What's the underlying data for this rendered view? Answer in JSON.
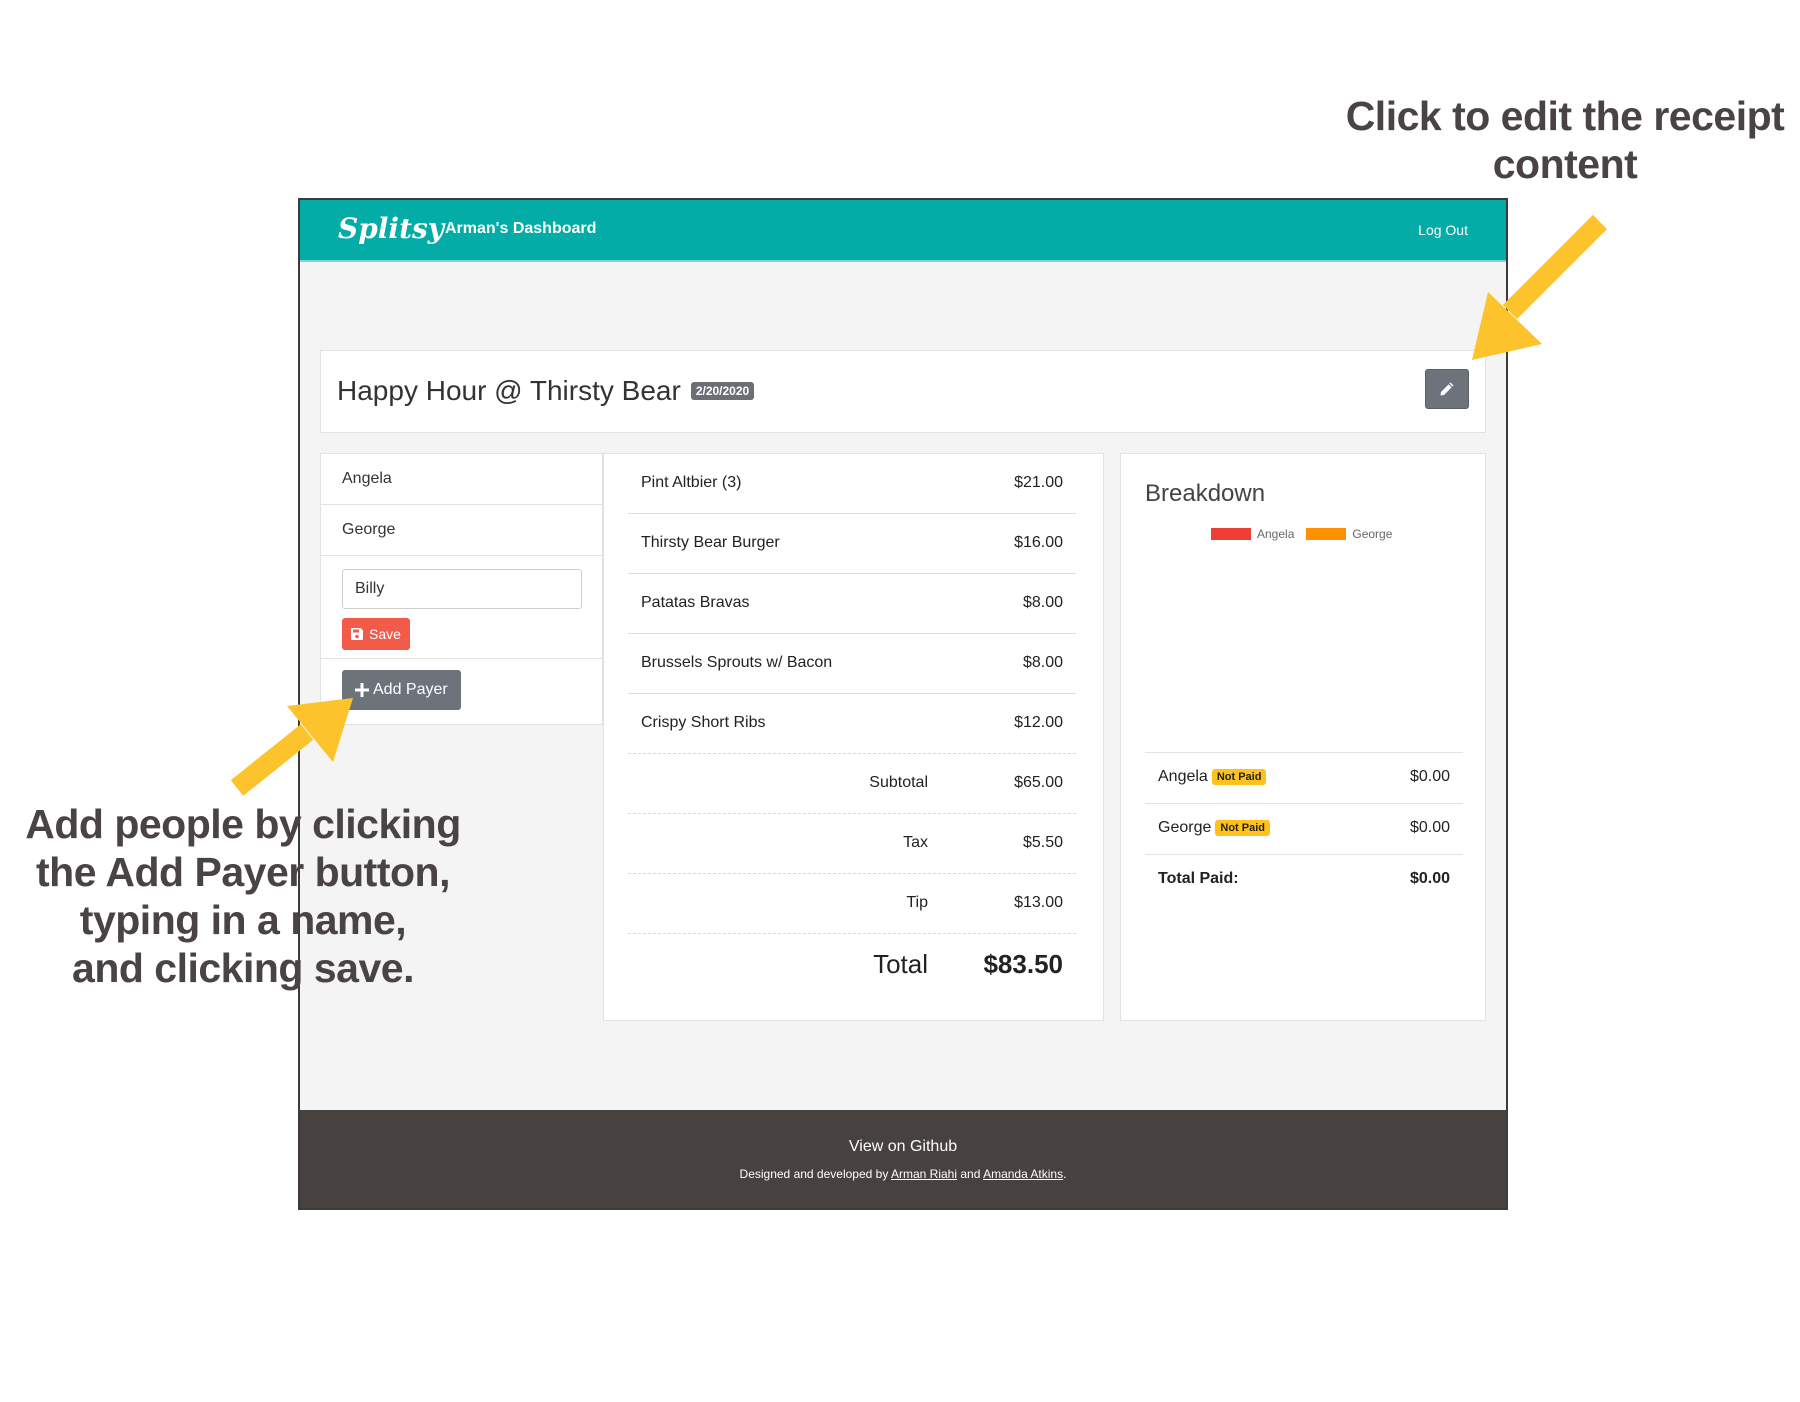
{
  "annotations": {
    "top_line1": "Click to edit the receipt",
    "top_line2": "content",
    "left_line1": "Add people by clicking",
    "left_line2": "the Add Payer button,",
    "left_line3": "typing in a name,",
    "left_line4": "and clicking save."
  },
  "navbar": {
    "brand": "Splitsy",
    "dashboard_title": "Arman's Dashboard",
    "logout_label": "Log Out"
  },
  "receipt": {
    "title": "Happy Hour @ Thirsty Bear",
    "date": "2/20/2020"
  },
  "payers": {
    "items": [
      {
        "name": "Angela"
      },
      {
        "name": "George"
      }
    ],
    "input_value": "Billy",
    "save_label": "Save",
    "add_label": "Add Payer"
  },
  "items": [
    {
      "name": "Pint Altbier (3)",
      "price": "$21.00"
    },
    {
      "name": "Thirsty Bear Burger",
      "price": "$16.00"
    },
    {
      "name": "Patatas Bravas",
      "price": "$8.00"
    },
    {
      "name": "Brussels Sprouts w/ Bacon",
      "price": "$8.00"
    },
    {
      "name": "Crispy Short Ribs",
      "price": "$12.00"
    }
  ],
  "totals": {
    "subtotal_label": "Subtotal",
    "subtotal": "$65.00",
    "tax_label": "Tax",
    "tax": "$5.50",
    "tip_label": "Tip",
    "tip": "$13.00",
    "total_label": "Total",
    "total": "$83.50"
  },
  "breakdown": {
    "title": "Breakdown",
    "legend": [
      {
        "name": "Angela",
        "color": "#ef3e36"
      },
      {
        "name": "George",
        "color": "#ff9000"
      }
    ],
    "rows": [
      {
        "name": "Angela",
        "status": "Not Paid",
        "amount": "$0.00"
      },
      {
        "name": "George",
        "status": "Not Paid",
        "amount": "$0.00"
      }
    ],
    "total_label": "Total Paid:",
    "total_amount": "$0.00"
  },
  "footer": {
    "github_label": "View on Github",
    "credits_prefix": "Designed and developed by",
    "author1": "Arman Riahi",
    "credits_and": "and",
    "author2": "Amanda Atkins",
    "credits_suffix": "."
  }
}
